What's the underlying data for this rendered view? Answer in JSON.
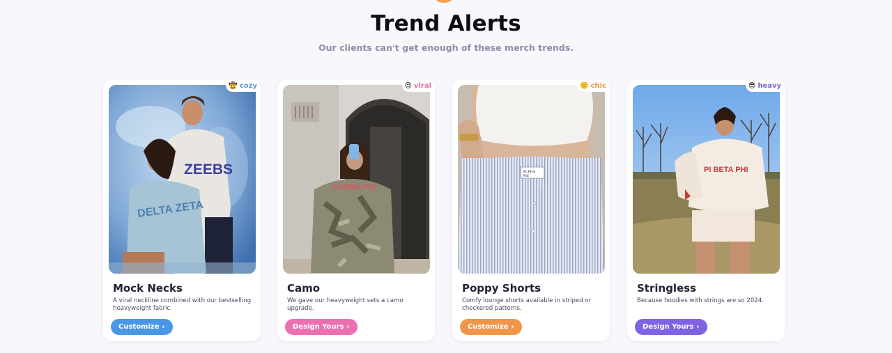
{
  "header": {
    "title": "Trend Alerts",
    "subtitle": "Our clients can't get enough of these merch trends."
  },
  "cards": [
    {
      "badge_emoji": "🤠",
      "badge": "cozy",
      "badge_color": "#5a9bd5",
      "title": "Mock Necks",
      "desc": "A viral neckline combined with our bestselling heavyweight fabric.",
      "cta": "Customize",
      "cta_color": "#4a97e6"
    },
    {
      "badge_emoji": "😍",
      "badge": "viral",
      "badge_color": "#e66aa9",
      "title": "Camo",
      "desc": "We gave our heavyweight sets a camo upgrade.",
      "cta": "Design Yours",
      "cta_color": "#ec6fb1"
    },
    {
      "badge_emoji": "🙂",
      "badge": "chic",
      "badge_color": "#e8943b",
      "title": "Poppy Shorts",
      "desc": "Comfy lounge shorts available in striped or checkered patterns.",
      "cta": "Customize",
      "cta_color": "#f0964b"
    },
    {
      "badge_emoji": "😎",
      "badge": "heavy",
      "badge_color": "#7d62d9",
      "title": "Stringless",
      "desc": "Because hoodies with strings are so 2024.",
      "cta": "Design Yours",
      "cta_color": "#7f63e4"
    }
  ],
  "chevron": "›"
}
